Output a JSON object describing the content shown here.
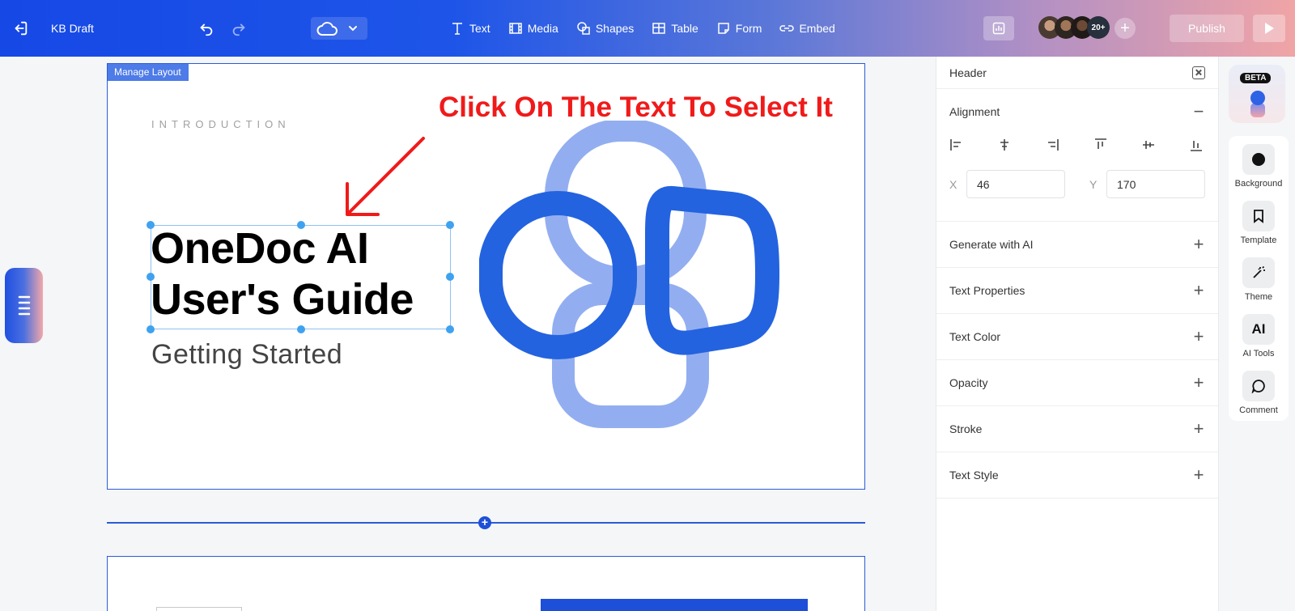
{
  "topbar": {
    "doc_title": "KB Draft",
    "tools": [
      {
        "label": "Text",
        "icon": "text-icon"
      },
      {
        "label": "Media",
        "icon": "media-icon"
      },
      {
        "label": "Shapes",
        "icon": "shapes-icon"
      },
      {
        "label": "Table",
        "icon": "table-icon"
      },
      {
        "label": "Form",
        "icon": "form-icon"
      },
      {
        "label": "Embed",
        "icon": "embed-icon"
      }
    ],
    "collaborators_more": "20+",
    "publish_label": "Publish",
    "gradient_start": "#1648e6",
    "gradient_end": "#f0a4a6"
  },
  "slide1": {
    "manage_layout": "Manage Layout",
    "intro": "INTRODUCTION",
    "heading_line1": "OneDoc AI",
    "heading_line2": "User's Guide",
    "subheading": "Getting Started",
    "annotation": "Click On The Text To Select It",
    "annotation_color": "#f01a1a"
  },
  "panel": {
    "title": "Header",
    "alignment_label": "Alignment",
    "x_label": "X",
    "x_value": "46",
    "y_label": "Y",
    "y_value": "170",
    "sections": [
      "Generate with AI",
      "Text Properties",
      "Text Color",
      "Opacity",
      "Stroke",
      "Text Style"
    ]
  },
  "rail": {
    "beta": "BETA",
    "items": [
      {
        "label": "Background",
        "icon": "circle-icon"
      },
      {
        "label": "Template",
        "icon": "bookmark-icon"
      },
      {
        "label": "Theme",
        "icon": "magic-wand-icon"
      },
      {
        "label": "AI Tools",
        "icon": "ai-icon",
        "glyph": "AI"
      },
      {
        "label": "Comment",
        "icon": "comment-icon"
      }
    ]
  },
  "colors": {
    "accent": "#1e4fd8",
    "logo_dark": "#2463df",
    "logo_light": "#93aef0"
  }
}
